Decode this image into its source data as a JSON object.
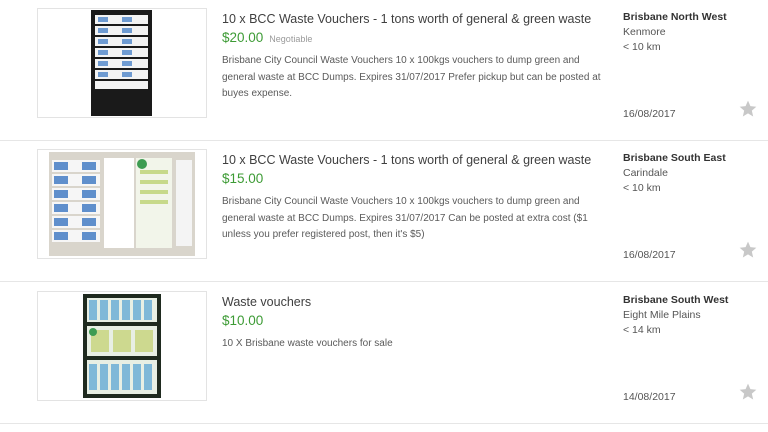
{
  "listings": [
    {
      "title": "10 x BCC Waste Vouchers - 1 tons worth of general & green waste",
      "price": "$20.00",
      "price_tag": "Negotiable",
      "description": "Brisbane City Council Waste Vouchers 10 x 100kgs vouchers to dump green and general waste at BCC Dumps. Expires 31/07/2017 Prefer pickup but can be posted at buyes expense.",
      "region": "Brisbane North West",
      "suburb": "Kenmore",
      "distance": "< 10 km",
      "date": "16/08/2017",
      "icon": "star-icon"
    },
    {
      "title": "10 x BCC Waste Vouchers - 1 tons worth of general & green waste",
      "price": "$15.00",
      "price_tag": "",
      "description": "Brisbane City Council Waste Vouchers 10 x 100kgs vouchers to dump green and general waste at BCC Dumps. Expires 31/07/2017 Can be posted at extra cost ($1 unless you prefer registered post, then it's $5)",
      "region": "Brisbane South East",
      "suburb": "Carindale",
      "distance": "< 10 km",
      "date": "16/08/2017",
      "icon": "star-icon"
    },
    {
      "title": "Waste vouchers",
      "price": "$10.00",
      "price_tag": "",
      "description": "10 X Brisbane waste vouchers for sale",
      "region": "Brisbane South West",
      "suburb": "Eight Mile Plains",
      "distance": "< 14 km",
      "date": "14/08/2017",
      "icon": "star-icon"
    }
  ],
  "colors": {
    "price_green": "#3d9b35",
    "star_grey": "#c8c8c8",
    "divider": "#e6e6e6"
  }
}
